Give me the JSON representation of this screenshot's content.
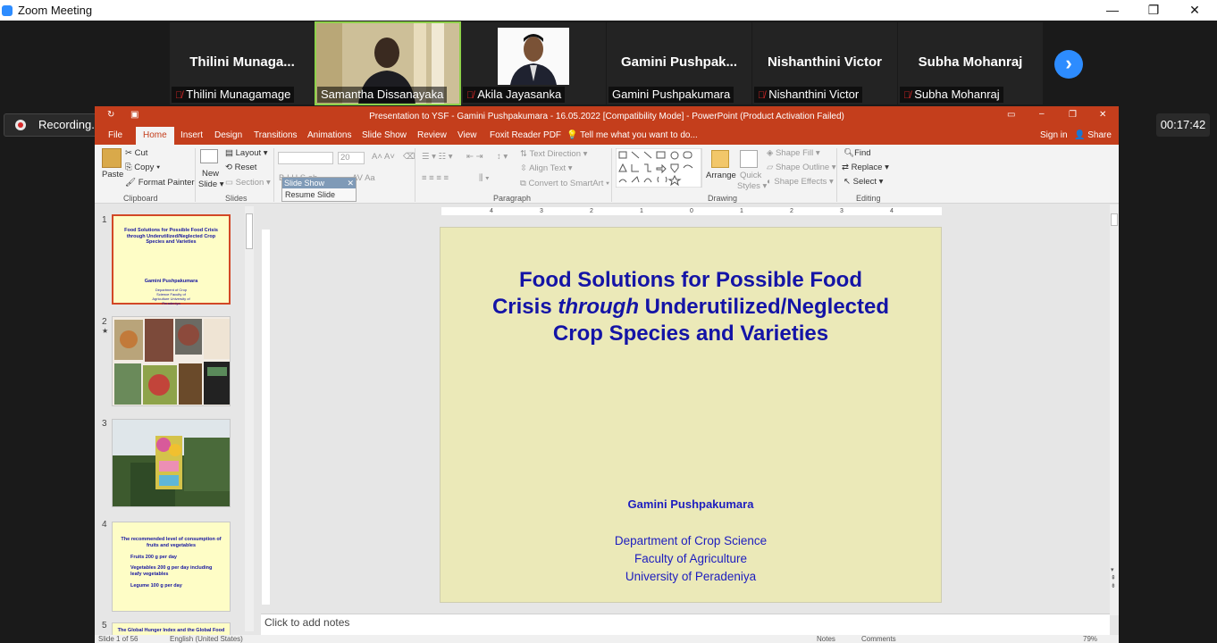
{
  "window": {
    "title": "Zoom Meeting",
    "minimize": "—",
    "restore": "❐",
    "close": "✕"
  },
  "participants": [
    {
      "big_name": "Thilini  Munaga...",
      "label": "Thilini Munagamage"
    },
    {
      "big_name": "",
      "label": "Samantha Dissanayaka"
    },
    {
      "big_name": "",
      "label": "Akila Jayasanka"
    },
    {
      "big_name": "Gamini  Pushpak...",
      "label": "Gamini Pushpakumara"
    },
    {
      "big_name": "Nishanthini Victor",
      "label": "Nishanthini Victor"
    },
    {
      "big_name": "Subha Mohanraj",
      "label": "Subha Mohanraj"
    }
  ],
  "recording": {
    "label": "Recording..."
  },
  "timer": "00:17:42",
  "ppt": {
    "title": "Presentation to YSF - Gamini Pushpakumara - 16.05.2022 [Compatibility Mode] - PowerPoint (Product Activation Failed)",
    "tabs": [
      "File",
      "Home",
      "Insert",
      "Design",
      "Transitions",
      "Animations",
      "Slide Show",
      "Review",
      "View",
      "Foxit Reader PDF"
    ],
    "tell_me": "Tell me what you want to do...",
    "sign_in": "Sign in",
    "share": "Share",
    "ribbon": {
      "paste": "Paste",
      "cut": "Cut",
      "copy": "Copy",
      "format_painter": "Format Painter",
      "clipboard": "Clipboard",
      "new_slide": "New",
      "new_slide2": "Slide",
      "layout": "Layout",
      "reset": "Reset",
      "section": "Section",
      "slides": "Slides",
      "font_size": "20",
      "text_direction": "Text Direction",
      "align_text": "Align Text",
      "convert_smartart": "Convert to SmartArt",
      "paragraph": "Paragraph",
      "arrange": "Arrange",
      "quick_styles": "Quick",
      "quick_styles2": "Styles",
      "shape_fill": "Shape Fill",
      "shape_outline": "Shape Outline",
      "shape_effects": "Shape Effects",
      "drawing": "Drawing",
      "find": "Find",
      "replace": "Replace",
      "select": "Select",
      "editing": "Editing"
    },
    "popup": {
      "title": "Slide Show",
      "resume": "Resume Slide Show"
    },
    "thumbs": [
      {
        "num": "1",
        "title": "Food Solutions for Possible Food Crisis through Underutilized/Neglected Crop Species and Varieties",
        "author": "Gamini Pushpakumara",
        "aff": "Department of Crop Science Faculty of Agriculture University of Peradeniya"
      },
      {
        "num": "2"
      },
      {
        "num": "3"
      },
      {
        "num": "4",
        "title": "The recommended level of consumption of fruits and vegetables",
        "l1": "Fruits 200 g per day",
        "l2": "Vegetables 200 g per day including leafy vegetables",
        "l3": "Legume 100 g per day"
      },
      {
        "num": "5",
        "title": "The Global Hunger Index and the Global Food"
      }
    ],
    "ruler_ticks": [
      "4",
      "3",
      "2",
      "1",
      "0",
      "1",
      "2",
      "3",
      "4"
    ],
    "slide": {
      "title_1": "Food Solutions for Possible Food",
      "title_2a": "Crisis ",
      "title_2b": "through",
      "title_2c": " Underutilized/Neglected",
      "title_3": "Crop Species and Varieties",
      "author": "Gamini Pushpakumara",
      "aff_1": "Department of Crop Science",
      "aff_2": "Faculty of Agriculture",
      "aff_3": "University of Peradeniya"
    },
    "notes": "Click to add notes",
    "status": {
      "slide": "Slide 1 of 56",
      "lang": "English (United States)",
      "notes": "Notes",
      "comments": "Comments",
      "zoom": "79%"
    }
  }
}
